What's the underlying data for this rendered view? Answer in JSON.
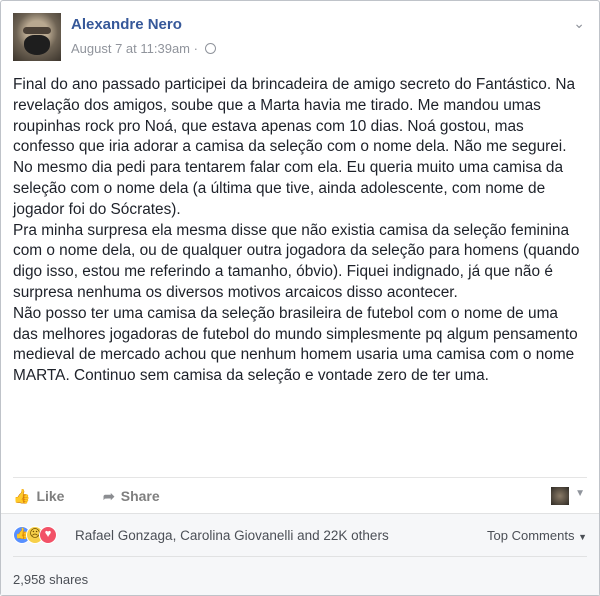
{
  "post": {
    "author": "Alexandre Nero",
    "timestamp": "August 7 at 11:39am · ",
    "body": "Final do ano passado participei da brincadeira de amigo secreto do Fantástico. Na revelação dos amigos, soube que a Marta havia me tirado. Me mandou umas roupinhas rock pro Noá, que estava apenas com 10 dias. Noá gostou, mas confesso que iria adorar a camisa da seleção com o nome dela. Não me segurei. No mesmo dia pedi para tentarem falar com ela. Eu queria muito uma camisa da seleção com o nome dela (a última que tive, ainda adolescente, com nome de jogador foi do Sócrates).\nPra minha surpresa ela mesma disse que não existia camisa da seleção feminina com o nome dela, ou de qualquer outra jogadora da seleção para homens (quando digo isso, estou me referindo a tamanho, óbvio). Fiquei indignado, já que não é surpresa nenhuma os diversos motivos arcaicos disso acontecer.\nNão posso ter uma camisa da seleção brasileira de futebol com o nome de uma das melhores jogadoras de futebol do mundo simplesmente pq algum pensamento medieval de mercado achou que nenhum homem usaria uma camisa com o nome MARTA. Continuo sem camisa da seleção e vontade zero de ter uma."
  },
  "actions": {
    "like": "Like",
    "share": "Share"
  },
  "reactions": {
    "names": "Rafael Gonzaga, Carolina Giovanelli and 22K others",
    "top_comments": "Top Comments",
    "shares": "2,958 shares"
  }
}
